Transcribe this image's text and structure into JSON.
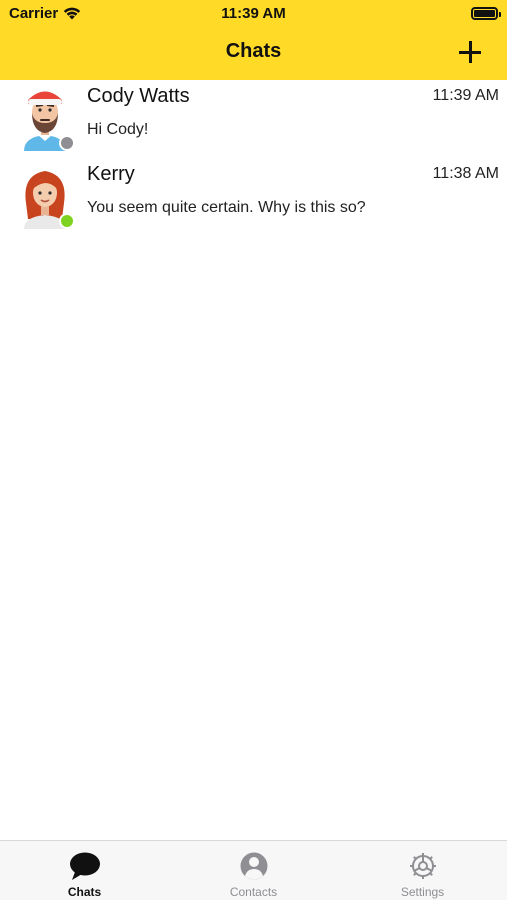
{
  "status_bar": {
    "carrier": "Carrier",
    "time": "11:39 AM"
  },
  "header": {
    "title": "Chats",
    "add_icon": "plus-icon"
  },
  "chats": [
    {
      "name": "Cody Watts",
      "time": "11:39 AM",
      "preview": "Hi Cody!",
      "presence": "offline",
      "presence_color": "#8E8E93"
    },
    {
      "name": "Kerry",
      "time": "11:38 AM",
      "preview": "You seem quite certain. Why is this so?",
      "presence": "online",
      "presence_color": "#7ED321"
    }
  ],
  "tabs": [
    {
      "label": "Chats",
      "icon": "chat-bubble-icon",
      "active": true
    },
    {
      "label": "Contacts",
      "icon": "person-circle-icon",
      "active": false
    },
    {
      "label": "Settings",
      "icon": "gear-icon",
      "active": false
    }
  ],
  "colors": {
    "accent": "#FFDA27",
    "tab_inactive": "#8E8E93",
    "tab_active": "#111111"
  }
}
